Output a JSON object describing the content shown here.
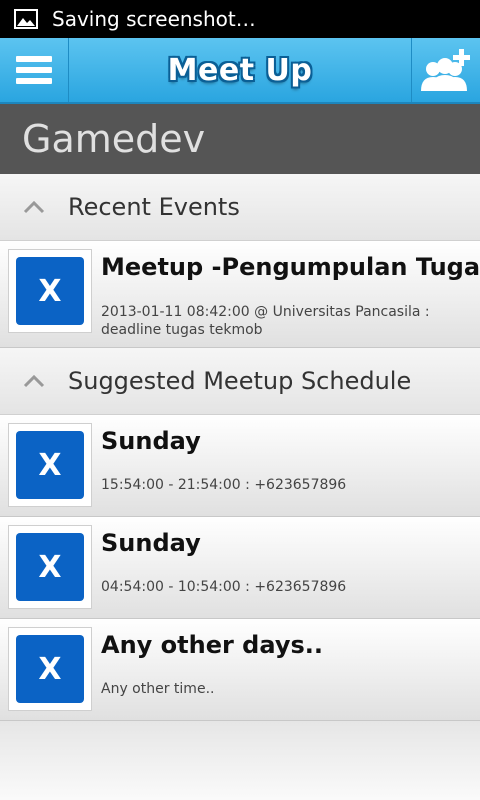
{
  "status_bar": {
    "text": "Saving screenshot…",
    "icon": "image-icon"
  },
  "app_bar": {
    "title": "Meet Up",
    "menu_icon": "hamburger-icon",
    "action_icon": "add-user-icon",
    "color": "#2aa5e0"
  },
  "section": {
    "title": "Gamedev"
  },
  "groups": [
    {
      "label": "Recent Events",
      "items": [
        {
          "title": "Meetup -Pengumpulan Tugas",
          "desc_line1": "2013-01-11 08:42:00 @ Universitas Pancasila  :",
          "desc_line2": "deadline tugas tekmob",
          "thumb": "X"
        }
      ]
    },
    {
      "label": "Suggested Meetup Schedule",
      "items": [
        {
          "title": "Sunday",
          "desc_line1": "15:54:00 - 21:54:00  : +623657896",
          "thumb": "X"
        },
        {
          "title": "Sunday",
          "desc_line1": "04:54:00 - 10:54:00  : +623657896",
          "thumb": "X"
        },
        {
          "title": "Any other days..",
          "desc_line1": "Any other time..",
          "thumb": "X"
        }
      ]
    }
  ]
}
